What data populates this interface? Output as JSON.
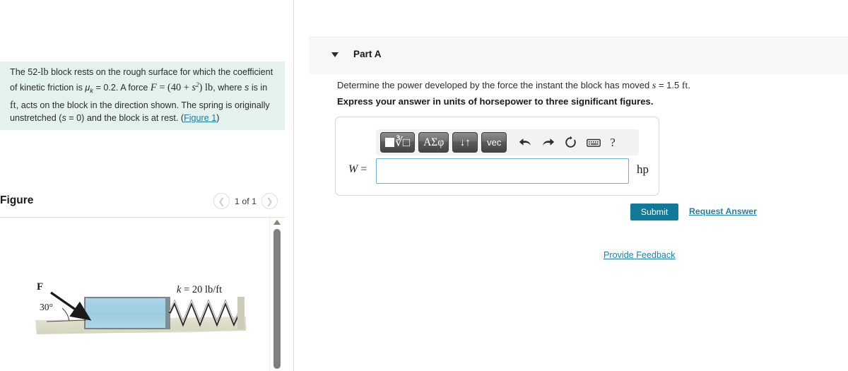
{
  "problem": {
    "text_part1": "The 52-",
    "unit_lb": "lb",
    "text_part2": " block rests on the rough surface for which the coefficient of kinetic friction is ",
    "mu_symbol": "μ",
    "mu_sub": "k",
    "mu_value": " = 0.2. A force ",
    "force_formula_F": "F",
    "force_formula_eq": " = (40 + ",
    "force_formula_s": "s",
    "force_formula_exp": "2",
    "force_formula_close": ") ",
    "force_unit": "lb",
    "text_part3": ", where ",
    "s_var": "s",
    "text_part4": " is in ",
    "unit_ft": "ft",
    "text_part5": ", acts on the block in the direction shown. The spring is originally unstretched (",
    "s_var2": "s",
    "text_part6": " = 0) and the block is at rest. (",
    "figure_link": "Figure 1",
    "text_part7": ")"
  },
  "figure": {
    "title": "Figure",
    "page_count": "1 of 1",
    "prev_icon": "chevron-left-icon",
    "next_icon": "chevron-right-icon",
    "force_label": "F",
    "angle_label": "30°",
    "spring_label_k": "k",
    "spring_label_value": " = 20 lb/ft",
    "block_color": "#9ccde0",
    "ground_color": "#dcdcc8"
  },
  "part": {
    "label": "Part A",
    "caret_icon": "chevron-down-icon",
    "question": "Determine the power developed by the force the instant the block has moved s = 1.5 ft.",
    "question_prefix": "Determine the power developed by the force the instant the block has moved ",
    "question_var": "s",
    "question_suffix": " = 1.5 ",
    "question_unit": "ft",
    "question_end": ".",
    "instruction": "Express your answer in units of horsepower to three significant figures."
  },
  "answer": {
    "variable": "W",
    "equals": " =",
    "value": "",
    "placeholder": "",
    "unit": "hp",
    "toolbar": {
      "template_label": "template-button",
      "greek_label": "ΑΣφ",
      "arrows_label": "↓↑",
      "vec_label": "vec",
      "undo_icon": "undo-arrow-icon",
      "redo_icon": "redo-arrow-icon",
      "reset_icon": "reset-circle-icon",
      "keyboard_icon": "keyboard-icon",
      "help_icon": "?"
    }
  },
  "actions": {
    "submit": "Submit",
    "request_answer": "Request Answer",
    "provide_feedback": "Provide Feedback"
  },
  "colors": {
    "submit_bg": "#117a98",
    "link": "#1d82a6",
    "problem_bg": "#e4f2ef",
    "header_bg": "#f7f7f7",
    "input_border": "#6db4cf"
  }
}
